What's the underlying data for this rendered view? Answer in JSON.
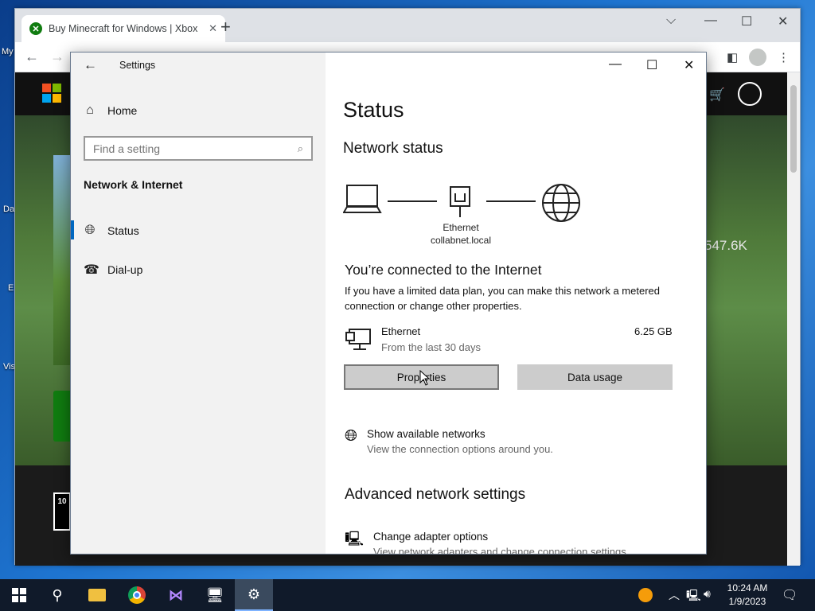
{
  "desktop": {
    "labels": [
      "My",
      "Da",
      "E",
      "Vis"
    ]
  },
  "browser": {
    "tab_title": "Buy Minecraft for Windows | Xbox",
    "new_tab": "+",
    "page": {
      "stat": "547.6K",
      "rating": "10"
    }
  },
  "settings": {
    "title": "Settings",
    "nav": {
      "home": "Home",
      "search_placeholder": "Find a setting",
      "section": "Network & Internet",
      "items": [
        {
          "label": "Status"
        },
        {
          "label": "Dial-up"
        }
      ]
    },
    "main": {
      "heading": "Status",
      "network_status": "Network status",
      "adapter_name": "Ethernet",
      "domain": "collabnet.local",
      "connected_title": "You’re connected to the Internet",
      "connected_desc": "If you have a limited data plan, you can make this network a metered connection or change other properties.",
      "ethernet": {
        "name": "Ethernet",
        "period": "From the last 30 days",
        "usage": "6.25 GB"
      },
      "buttons": {
        "properties": "Properties",
        "data_usage": "Data usage"
      },
      "show_networks": {
        "title": "Show available networks",
        "desc": "View the connection options around you."
      },
      "advanced_heading": "Advanced network settings",
      "adapter_options": {
        "title": "Change adapter options",
        "desc": "View network adapters and change connection settings."
      }
    }
  },
  "taskbar": {
    "time": "10:24 AM",
    "date": "1/9/2023"
  },
  "colors": {
    "accent": "#0067c0",
    "xbox_green": "#107c10"
  }
}
